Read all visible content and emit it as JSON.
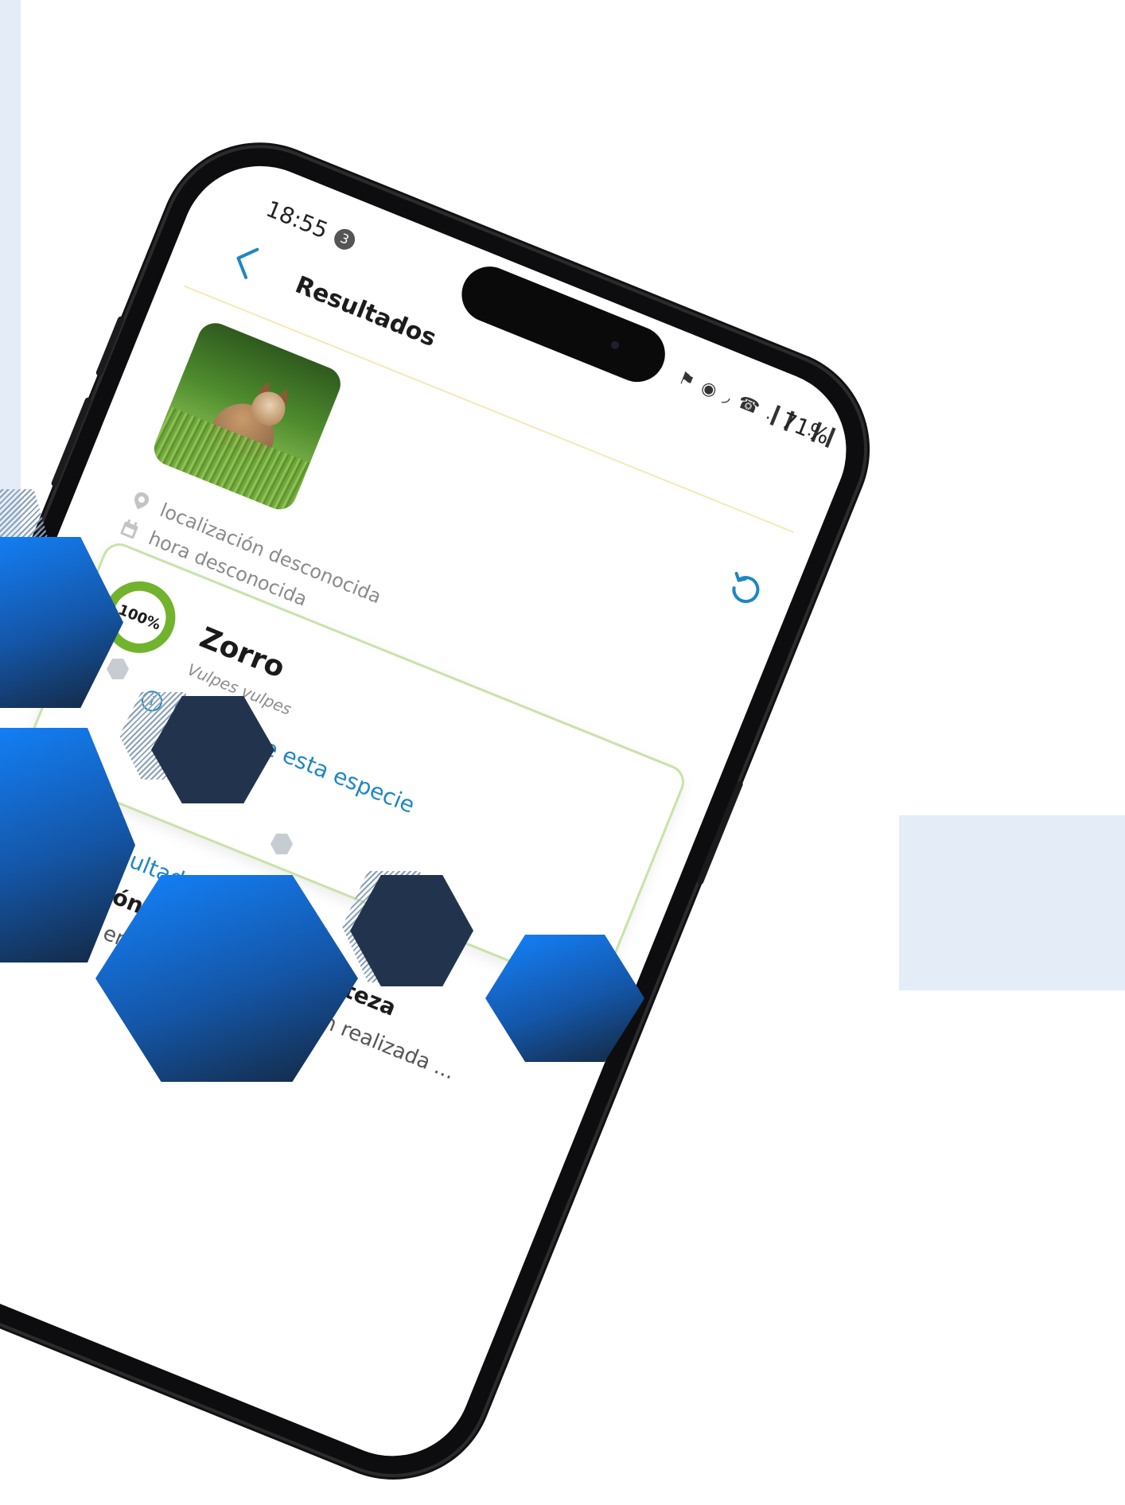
{
  "status_bar": {
    "time": "18:55",
    "notification_count": "3",
    "system_icons": "⚑ ◉ ◞ ☎ .▎▎ .▎▎",
    "battery": "71%"
  },
  "header": {
    "title": "Resultados"
  },
  "observation": {
    "location": "localización desconocida",
    "time": "hora desconocida"
  },
  "top_result": {
    "confidence": "100%",
    "confidence_value": 1.0,
    "common_name": "Zorro",
    "scientific_name": "Vulpes vulpes",
    "more_link": "Más sobre esta especie"
  },
  "all_results_link": "todos los resultados",
  "notice": {
    "title": "Identificación obtenida con certeza",
    "body": "Sin ubicación en la foto. Identificación realizada ..."
  },
  "colors": {
    "accent": "#1f86c4",
    "success": "#72b32d",
    "card_border": "#c8e3a9",
    "hex_blue": "#1384ff",
    "hex_navy": "#22344d",
    "background_tint": "#e3ecf7"
  }
}
